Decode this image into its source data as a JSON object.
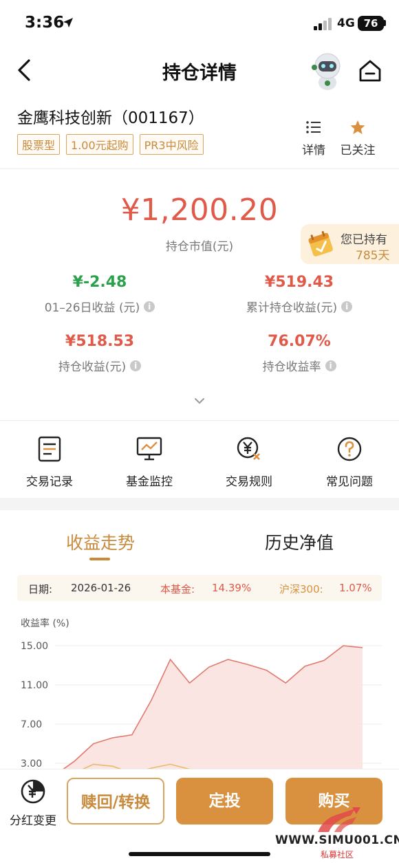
{
  "status": {
    "time": "3:36",
    "network": "4G",
    "battery": "76"
  },
  "nav": {
    "title": "持仓详情"
  },
  "fund": {
    "name": "金鹰科技创新（001167）",
    "tags": [
      "股票型",
      "1.00元起购",
      "PR3中风险"
    ],
    "detail_label": "详情",
    "follow_label": "已关注"
  },
  "holding": {
    "market_value": "¥1,200.20",
    "market_value_label": "持仓市值(元)",
    "hold_days_label": "您已持有",
    "hold_days_value": "785天",
    "metrics": [
      {
        "value": "¥-2.48",
        "label": "01–26日收益 (元)"
      },
      {
        "value": "¥519.43",
        "label": "累计持仓收益(元)"
      },
      {
        "value": "¥518.53",
        "label": "持仓收益(元)"
      },
      {
        "value": "76.07%",
        "label": "持仓收益率"
      }
    ]
  },
  "quick_actions": [
    "交易记录",
    "基金监控",
    "交易规则",
    "常见问题"
  ],
  "tabs": {
    "active": "收益走势",
    "other": "历史净值"
  },
  "date_info": {
    "date_label": "日期:",
    "date_value": "2026-01-26",
    "fund_label": "本基金:",
    "fund_value": "14.39%",
    "index_label": "沪深300:",
    "index_value": "1.07%"
  },
  "chart_data": {
    "type": "area",
    "ylabel": "收益率 (%)",
    "y_ticks": [
      "15.00",
      "11.00",
      "7.00",
      "3.00"
    ],
    "ylim": [
      0,
      15.5
    ],
    "series": [
      {
        "name": "本基金",
        "values": [
          1.8,
          3.2,
          5.0,
          5.6,
          5.9,
          9.4,
          13.6,
          11.2,
          12.8,
          13.6,
          13.1,
          12.5,
          11.2,
          12.9,
          13.5,
          15.0,
          14.8
        ],
        "color": "#e07a6e"
      },
      {
        "name": "沪深300",
        "values": [
          1.5,
          2.0,
          2.9,
          2.7,
          2.0,
          2.5,
          2.9,
          2.4,
          2.2,
          2.1,
          2.0,
          2.1,
          2.2,
          2.0,
          1.9,
          1.6,
          1.07
        ],
        "color": "#e8b96a"
      }
    ]
  },
  "bottom": {
    "dividend_label": "分红变更",
    "redeem_label": "赎回/转换",
    "sip_label": "定投",
    "buy_label": "购买"
  },
  "watermark": {
    "text": "WWW.SIMU001.CN",
    "sub": "私募社区"
  },
  "colors": {
    "accent": "#c88a3c",
    "red": "#e05a4a",
    "green": "#2aa14a"
  }
}
